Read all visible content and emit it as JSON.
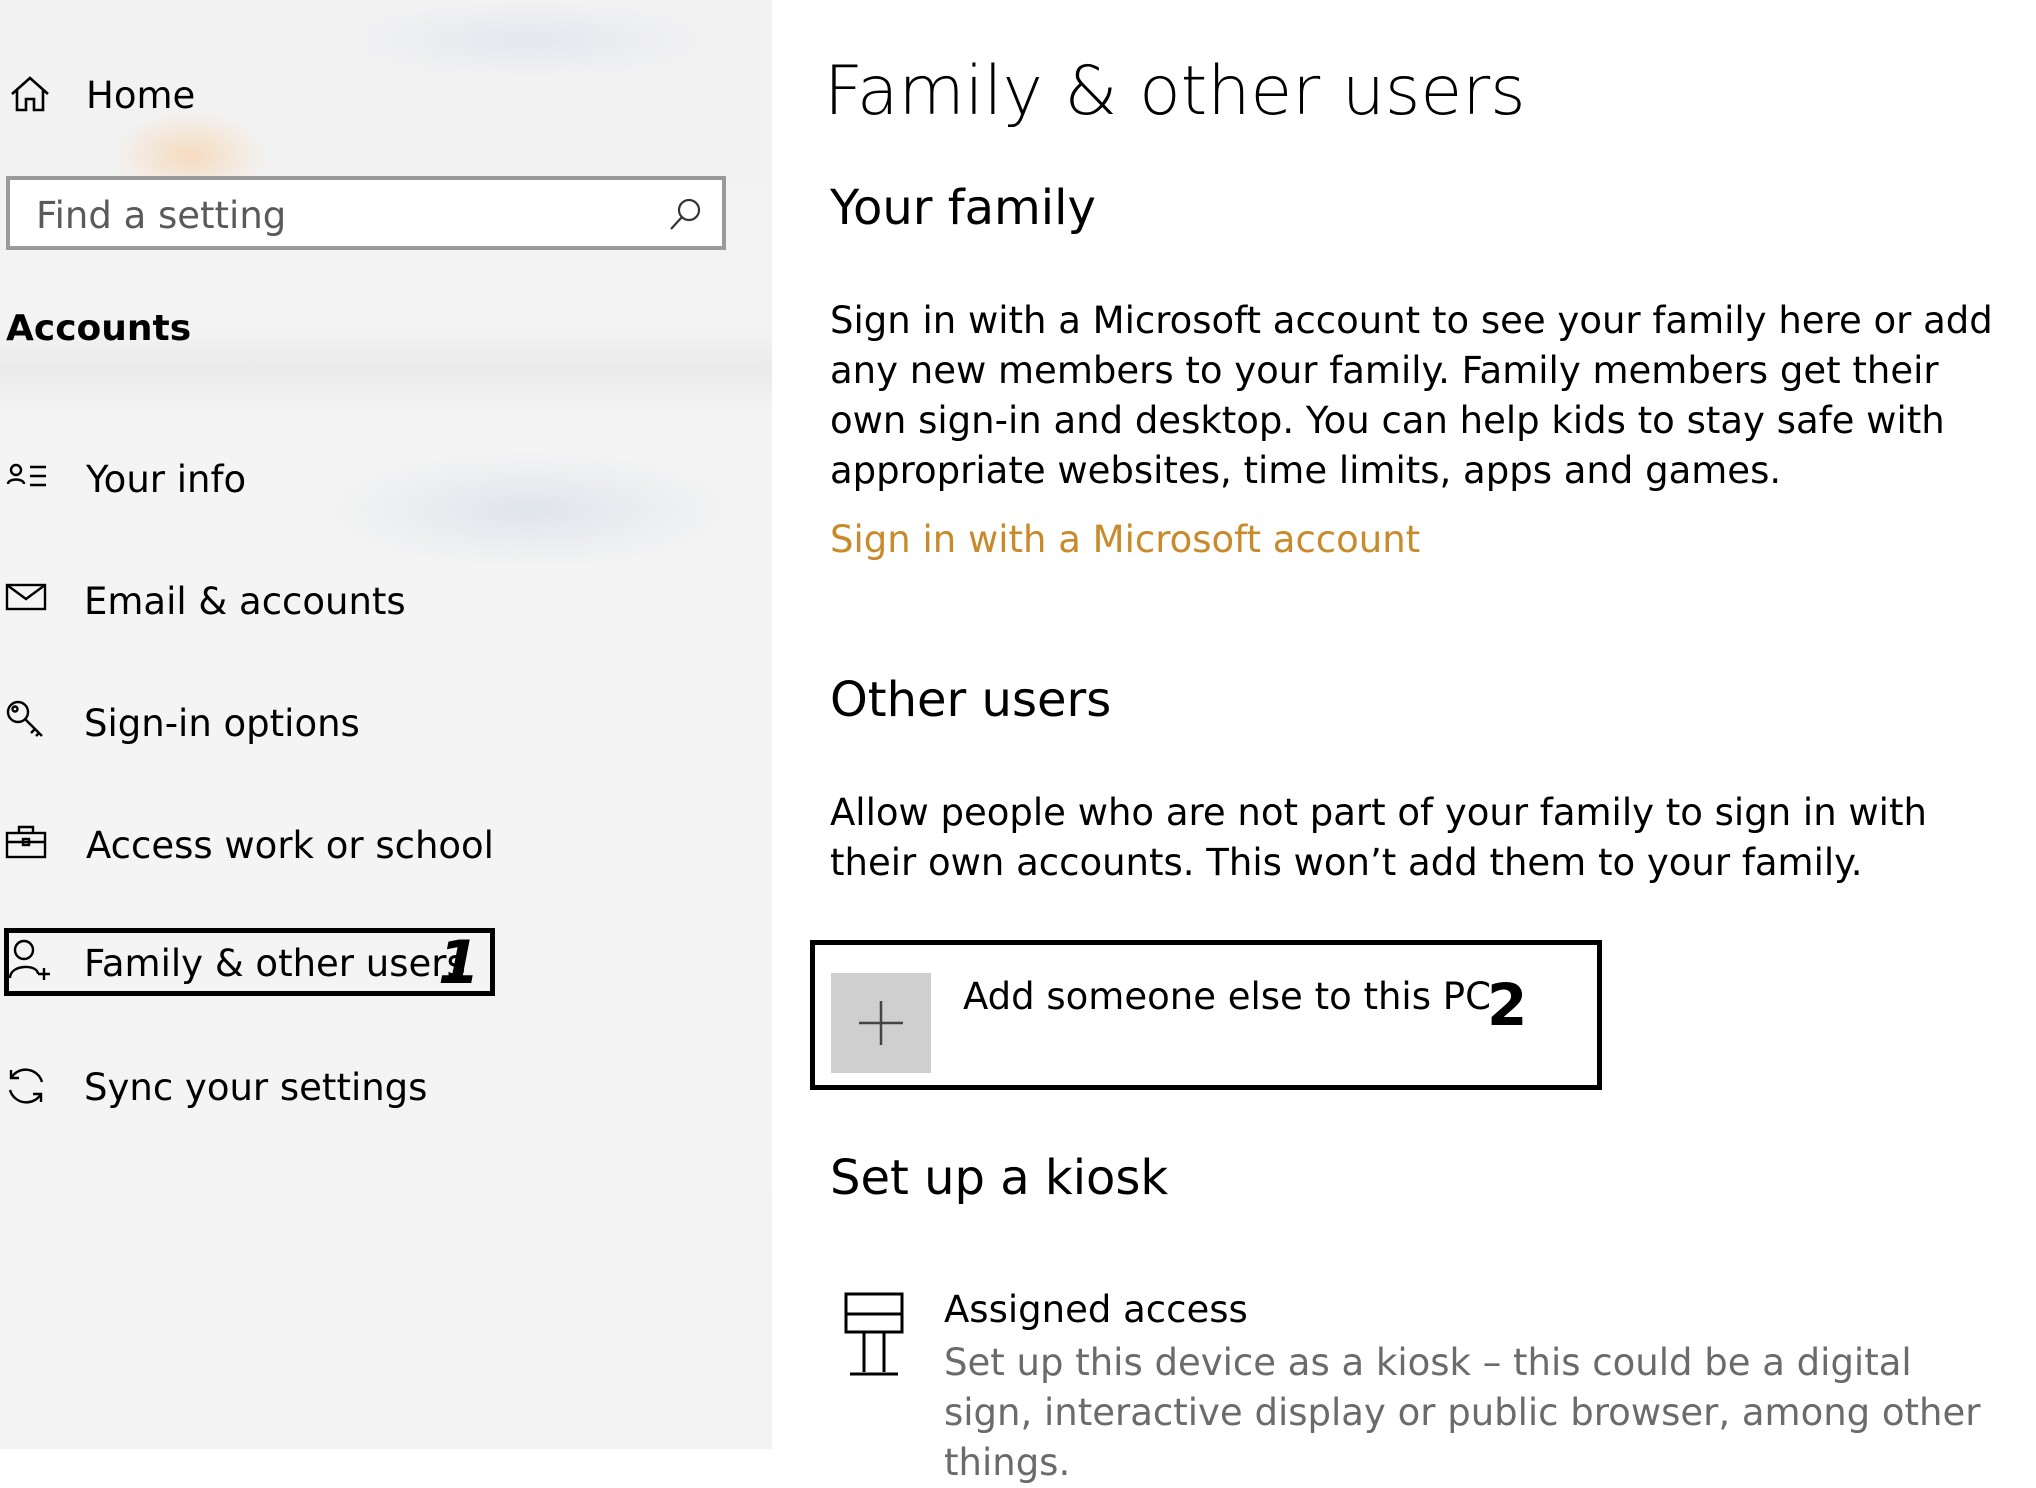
{
  "sidebar": {
    "home_label": "Home",
    "search_placeholder": "Find a setting",
    "section_title": "Accounts",
    "items": [
      {
        "label": "Your info",
        "icon": "contact-card-icon"
      },
      {
        "label": "Email & accounts",
        "icon": "mail-icon"
      },
      {
        "label": "Sign-in options",
        "icon": "key-icon"
      },
      {
        "label": "Access work or school",
        "icon": "briefcase-icon"
      },
      {
        "label": "Family & other users",
        "icon": "add-person-icon",
        "selected": true
      },
      {
        "label": "Sync your settings",
        "icon": "sync-icon"
      }
    ],
    "annotation_1": "1"
  },
  "main": {
    "page_title": "Family & other users",
    "your_family": {
      "heading": "Your family",
      "description": "Sign in with a Microsoft account to see your family here or add any new members to your family. Family members get their own sign-in and desktop. You can help kids to stay safe with appropriate websites, time limits, apps and games.",
      "link": "Sign in with a Microsoft account"
    },
    "other_users": {
      "heading": "Other users",
      "description": "Allow people who are not part of your family to sign in with their own accounts. This won’t add them to your family.",
      "add_button_label": "Add someone else to this PC",
      "annotation_2": "2"
    },
    "kiosk": {
      "heading": "Set up a kiosk",
      "title": "Assigned access",
      "description": "Set up this device as a kiosk – this could be a digital sign, interactive display or public browser, among other things."
    }
  },
  "colors": {
    "link": "#c88a2a",
    "sidebar_bg": "#f3f3f3",
    "plus_tile": "#cfcfcf",
    "secondary_text": "#6b6b6b"
  }
}
